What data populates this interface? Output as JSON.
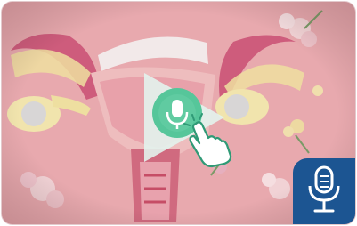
{
  "video": {
    "thumbnail_icon": "uterus-illustration",
    "play_icon": "play-icon",
    "voice_icon": "microphone-icon",
    "pointer_icon": "hand-pointer-icon"
  },
  "badge": {
    "icon": "microphone-icon",
    "color": "#1c5592"
  },
  "colors": {
    "background": "#e6a8ad",
    "accent_green": "#56c69a",
    "play_overlay": "#dff4ee"
  }
}
